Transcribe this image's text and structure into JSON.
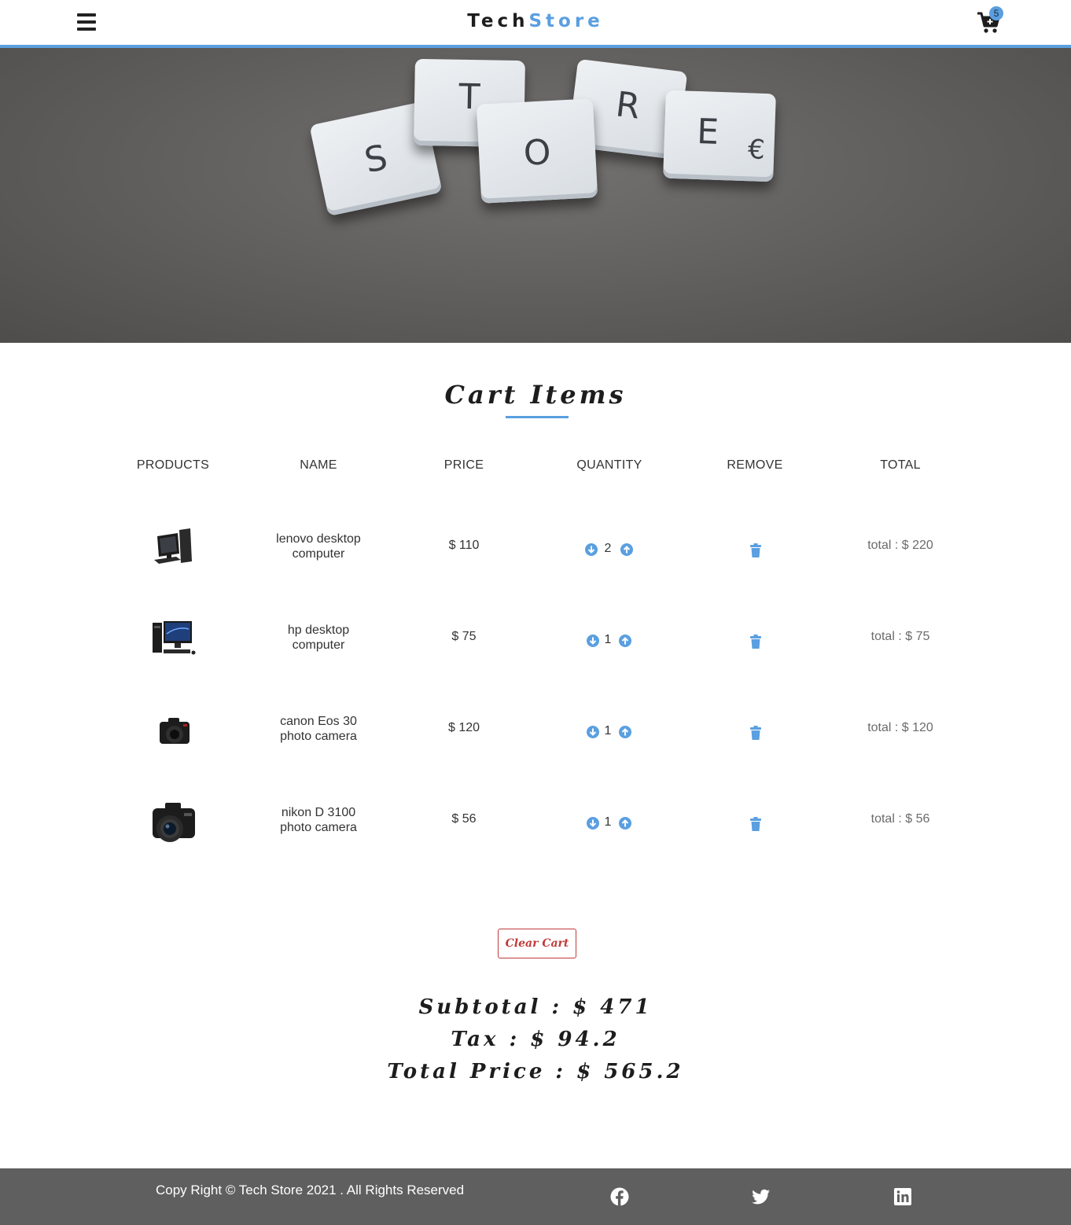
{
  "navbar": {
    "brand_part1": "Tech",
    "brand_part2": "Store",
    "cart_count": "5",
    "accent_color": "#5a9fe0"
  },
  "hero": {
    "tiles": [
      "S",
      "T",
      "O",
      "R",
      "E"
    ],
    "euro": "€"
  },
  "cart": {
    "title": "Cart Items",
    "columns": [
      "PRODUCTS",
      "NAME",
      "PRICE",
      "QUANTITY",
      "REMOVE",
      "TOTAL"
    ],
    "rows": [
      {
        "name_line1": "lenovo desktop",
        "name_line2": "computer",
        "price": "$ 110",
        "quantity": "2",
        "total": "total : $ 220",
        "thumb": "desktop-tower-icon"
      },
      {
        "name_line1": "hp desktop",
        "name_line2": "computer",
        "price": "$ 75",
        "quantity": "1",
        "total": "total : $ 75",
        "thumb": "desktop-monitor-icon"
      },
      {
        "name_line1": "canon Eos 30",
        "name_line2": "photo camera",
        "price": "$ 120",
        "quantity": "1",
        "total": "total : $ 120",
        "thumb": "camera-icon"
      },
      {
        "name_line1": "nikon D 3100",
        "name_line2": "photo camera",
        "price": "$ 56",
        "quantity": "1",
        "total": "total : $ 56",
        "thumb": "dslr-camera-icon"
      }
    ],
    "clear_label": "Clear Cart",
    "clear_color": "#c03a3a"
  },
  "totals": {
    "subtotal": "Subtotal : $ 471",
    "tax": "Tax : $ 94.2",
    "total_price": "Total Price : $ 565.2"
  },
  "footer": {
    "copyright": "Copy Right © Tech Store 2021 . All Rights Reserved",
    "social_icons": [
      "facebook-icon",
      "twitter-icon",
      "linkedin-icon"
    ]
  }
}
